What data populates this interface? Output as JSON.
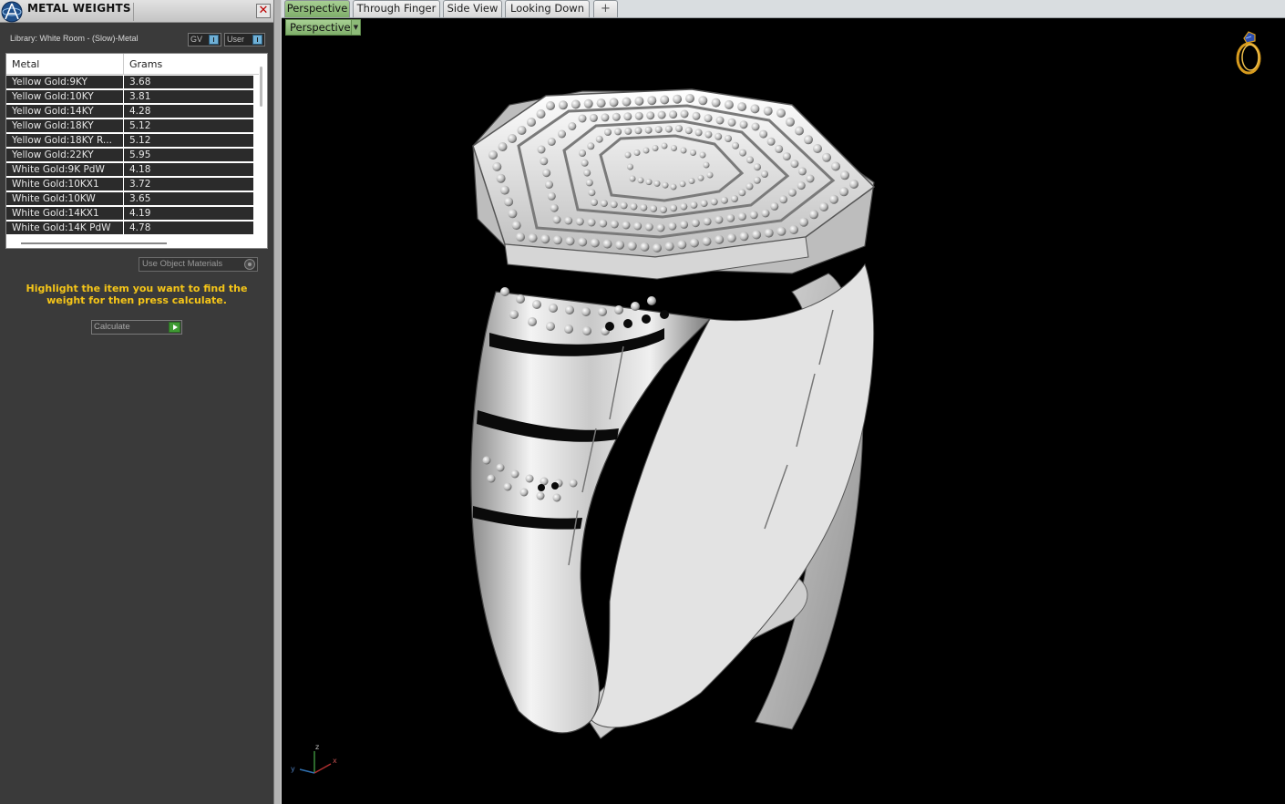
{
  "panel": {
    "title": "METAL WEIGHTS",
    "close_label": "✕",
    "library_label": "Library: White Room - (Slow)-Metal",
    "gv_toggle": "GV",
    "user_toggle": "User",
    "table": {
      "columns": [
        "Metal",
        "Grams"
      ],
      "rows": [
        {
          "metal": "Yellow Gold:9KY",
          "grams": "3.68"
        },
        {
          "metal": "Yellow Gold:10KY",
          "grams": "3.81"
        },
        {
          "metal": "Yellow Gold:14KY",
          "grams": "4.28"
        },
        {
          "metal": "Yellow Gold:18KY",
          "grams": "5.12"
        },
        {
          "metal": "Yellow Gold:18KY R...",
          "grams": "5.12"
        },
        {
          "metal": "Yellow Gold:22KY",
          "grams": "5.95"
        },
        {
          "metal": "White Gold:9K PdW",
          "grams": "4.18"
        },
        {
          "metal": "White Gold:10KX1",
          "grams": "3.72"
        },
        {
          "metal": "White Gold:10KW",
          "grams": "3.65"
        },
        {
          "metal": "White Gold:14KX1",
          "grams": "4.19"
        },
        {
          "metal": "White Gold:14K PdW",
          "grams": "4.78"
        }
      ]
    },
    "use_object_materials": "Use Object Materials",
    "instructions": "Highlight the item you want to find the weight for then press calculate.",
    "calculate_button": "Calculate"
  },
  "viewport": {
    "tabs": [
      "Perspective",
      "Through Finger",
      "Side View",
      "Looking Down"
    ],
    "active_tab": 0,
    "add_tab": "+",
    "view_dropdown": "Perspective",
    "axis_labels": {
      "x": "x",
      "y": "y",
      "z": "z"
    }
  },
  "colors": {
    "panel_bg": "#3a3a3a",
    "instruction_text": "#f5c518",
    "active_tab": "#8fbf7a",
    "viewport_bg": "#000000",
    "metal": "#e8e8e8"
  },
  "icons": {
    "app_logo": "matrix-logo-icon",
    "ring_logo": "gold-ring-icon",
    "axis": "xyz-axis-icon"
  }
}
